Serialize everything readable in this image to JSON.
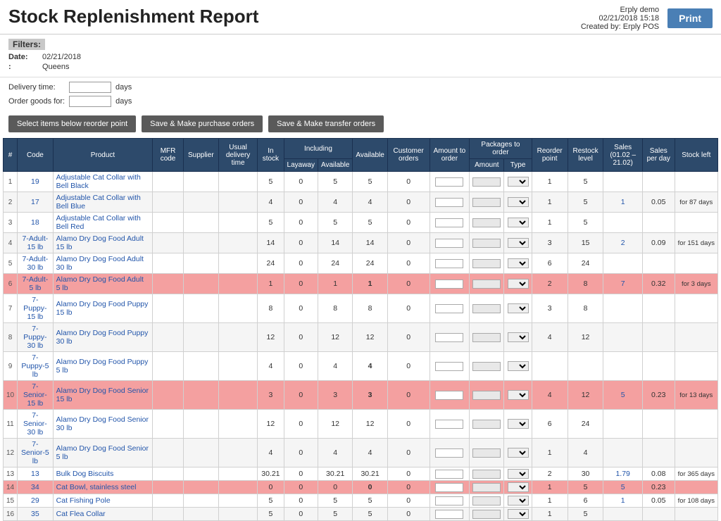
{
  "header": {
    "title": "Stock Replenishment Report",
    "company": "Erply demo",
    "datetime": "02/21/2018 15:18",
    "created_by": "Created by: Erply POS",
    "print_label": "Print"
  },
  "filters": {
    "label": "Filters:",
    "date_label": "Date:",
    "date_value": "02/21/2018",
    "location_label": ":",
    "location_value": "Queens"
  },
  "delivery": {
    "delivery_label": "Delivery time:",
    "delivery_unit": "days",
    "order_label": "Order goods for:",
    "order_unit": "days"
  },
  "buttons": {
    "select_items": "Select items below reorder point",
    "save_purchase": "Save & Make purchase orders",
    "save_transfer": "Save & Make transfer orders"
  },
  "table": {
    "col_headers": {
      "row_num": "#",
      "code": "Code",
      "product": "Product",
      "mfr_code": "MFR code",
      "supplier": "Supplier",
      "usual_delivery": "Usual delivery time",
      "in_stock": "In stock",
      "including": "Including",
      "layaway": "Layaway",
      "available": "Available",
      "customer_orders": "Customer orders",
      "amount_to_order": "Amount to order",
      "packages_to_order": "Packages to order",
      "amount": "Amount",
      "type": "Type",
      "reorder_point": "Reorder point",
      "restock_level": "Restock level",
      "sales": "Sales (01.02 – 21.02)",
      "sales_per_day": "Sales per day",
      "stock_left": "Stock left"
    },
    "rows": [
      {
        "num": "1",
        "code": "19",
        "product": "Adjustable Cat Collar with Bell Black",
        "mfr_code": "",
        "supplier": "",
        "usual_delivery": "",
        "in_stock": "5",
        "layaway": "0",
        "available": "5",
        "customer_orders": "0",
        "amount_to_order": "",
        "packages_amount": "",
        "packages_type": "",
        "reorder_point": "1",
        "restock_level": "5",
        "sales": "",
        "sales_per_day": "",
        "stock_left": "",
        "highlight": false
      },
      {
        "num": "2",
        "code": "17",
        "product": "Adjustable Cat Collar with Bell Blue",
        "mfr_code": "",
        "supplier": "",
        "usual_delivery": "",
        "in_stock": "4",
        "layaway": "0",
        "available": "4",
        "customer_orders": "0",
        "amount_to_order": "",
        "packages_amount": "",
        "packages_type": "",
        "reorder_point": "1",
        "restock_level": "5",
        "sales": "1",
        "sales_per_day": "0.05",
        "stock_left": "for 87 days",
        "highlight": false
      },
      {
        "num": "3",
        "code": "18",
        "product": "Adjustable Cat Collar with Bell Red",
        "mfr_code": "",
        "supplier": "",
        "usual_delivery": "",
        "in_stock": "5",
        "layaway": "0",
        "available": "5",
        "customer_orders": "0",
        "amount_to_order": "",
        "packages_amount": "",
        "packages_type": "",
        "reorder_point": "1",
        "restock_level": "5",
        "sales": "",
        "sales_per_day": "",
        "stock_left": "",
        "highlight": false
      },
      {
        "num": "4",
        "code": "7-Adult-15 lb",
        "product": "Alamo Dry Dog Food Adult 15 lb",
        "mfr_code": "",
        "supplier": "",
        "usual_delivery": "",
        "in_stock": "14",
        "layaway": "0",
        "available": "14",
        "customer_orders": "0",
        "amount_to_order": "",
        "packages_amount": "",
        "packages_type": "",
        "reorder_point": "3",
        "restock_level": "15",
        "sales": "2",
        "sales_per_day": "0.09",
        "stock_left": "for 151 days",
        "highlight": false
      },
      {
        "num": "5",
        "code": "7-Adult-30 lb",
        "product": "Alamo Dry Dog Food Adult 30 lb",
        "mfr_code": "",
        "supplier": "",
        "usual_delivery": "",
        "in_stock": "24",
        "layaway": "0",
        "available": "24",
        "customer_orders": "0",
        "amount_to_order": "",
        "packages_amount": "",
        "packages_type": "",
        "reorder_point": "6",
        "restock_level": "24",
        "sales": "",
        "sales_per_day": "",
        "stock_left": "",
        "highlight": false
      },
      {
        "num": "6",
        "code": "7-Adult-5 lb",
        "product": "Alamo Dry Dog Food Adult 5 lb",
        "mfr_code": "",
        "supplier": "",
        "usual_delivery": "",
        "in_stock": "1",
        "layaway": "0",
        "available": "1",
        "customer_orders": "0",
        "amount_to_order": "",
        "packages_amount": "",
        "packages_type": "",
        "reorder_point": "2",
        "restock_level": "8",
        "sales": "7",
        "sales_per_day": "0.32",
        "stock_left": "for 3 days",
        "highlight": true
      },
      {
        "num": "7",
        "code": "7-Puppy-15 lb",
        "product": "Alamo Dry Dog Food Puppy 15 lb",
        "mfr_code": "",
        "supplier": "",
        "usual_delivery": "",
        "in_stock": "8",
        "layaway": "0",
        "available": "8",
        "customer_orders": "0",
        "amount_to_order": "",
        "packages_amount": "",
        "packages_type": "",
        "reorder_point": "3",
        "restock_level": "8",
        "sales": "",
        "sales_per_day": "",
        "stock_left": "",
        "highlight": false
      },
      {
        "num": "8",
        "code": "7-Puppy-30 lb",
        "product": "Alamo Dry Dog Food Puppy 30 lb",
        "mfr_code": "",
        "supplier": "",
        "usual_delivery": "",
        "in_stock": "12",
        "layaway": "0",
        "available": "12",
        "customer_orders": "0",
        "amount_to_order": "",
        "packages_amount": "",
        "packages_type": "",
        "reorder_point": "4",
        "restock_level": "12",
        "sales": "",
        "sales_per_day": "",
        "stock_left": "",
        "highlight": false
      },
      {
        "num": "9",
        "code": "7-Puppy-5 lb",
        "product": "Alamo Dry Dog Food Puppy 5 lb",
        "mfr_code": "",
        "supplier": "",
        "usual_delivery": "",
        "in_stock": "4",
        "layaway": "0",
        "available": "4",
        "customer_orders": "0",
        "amount_to_order": "",
        "packages_amount": "",
        "packages_type": "",
        "reorder_point": "",
        "restock_level": "",
        "sales": "",
        "sales_per_day": "",
        "stock_left": "",
        "highlight": false
      },
      {
        "num": "10",
        "code": "7-Senior-15 lb",
        "product": "Alamo Dry Dog Food Senior 15 lb",
        "mfr_code": "",
        "supplier": "",
        "usual_delivery": "",
        "in_stock": "3",
        "layaway": "0",
        "available": "3",
        "customer_orders": "0",
        "amount_to_order": "",
        "packages_amount": "",
        "packages_type": "",
        "reorder_point": "4",
        "restock_level": "12",
        "sales": "5",
        "sales_per_day": "0.23",
        "stock_left": "for 13 days",
        "highlight": true
      },
      {
        "num": "11",
        "code": "7-Senior-30 lb",
        "product": "Alamo Dry Dog Food Senior 30 lb",
        "mfr_code": "",
        "supplier": "",
        "usual_delivery": "",
        "in_stock": "12",
        "layaway": "0",
        "available": "12",
        "customer_orders": "0",
        "amount_to_order": "",
        "packages_amount": "",
        "packages_type": "",
        "reorder_point": "6",
        "restock_level": "24",
        "sales": "",
        "sales_per_day": "",
        "stock_left": "",
        "highlight": false
      },
      {
        "num": "12",
        "code": "7-Senior-5 lb",
        "product": "Alamo Dry Dog Food Senior 5 lb",
        "mfr_code": "",
        "supplier": "",
        "usual_delivery": "",
        "in_stock": "4",
        "layaway": "0",
        "available": "4",
        "customer_orders": "0",
        "amount_to_order": "",
        "packages_amount": "",
        "packages_type": "",
        "reorder_point": "1",
        "restock_level": "4",
        "sales": "",
        "sales_per_day": "",
        "stock_left": "",
        "highlight": false
      },
      {
        "num": "13",
        "code": "13",
        "product": "Bulk Dog Biscuits",
        "mfr_code": "",
        "supplier": "",
        "usual_delivery": "",
        "in_stock": "30.21",
        "layaway": "0",
        "available": "30.21",
        "customer_orders": "0",
        "amount_to_order": "",
        "packages_amount": "",
        "packages_type": "",
        "reorder_point": "2",
        "restock_level": "30",
        "sales": "1.79",
        "sales_per_day": "0.08",
        "stock_left": "for 365 days",
        "highlight": false
      },
      {
        "num": "14",
        "code": "34",
        "product": "Cat Bowl, stainless steel",
        "mfr_code": "",
        "supplier": "",
        "usual_delivery": "",
        "in_stock": "0",
        "layaway": "0",
        "available": "0",
        "customer_orders": "0",
        "amount_to_order": "",
        "packages_amount": "",
        "packages_type": "",
        "reorder_point": "1",
        "restock_level": "5",
        "sales": "5",
        "sales_per_day": "0.23",
        "stock_left": "",
        "highlight": true
      },
      {
        "num": "15",
        "code": "29",
        "product": "Cat Fishing Pole",
        "mfr_code": "",
        "supplier": "",
        "usual_delivery": "",
        "in_stock": "5",
        "layaway": "0",
        "available": "5",
        "customer_orders": "0",
        "amount_to_order": "",
        "packages_amount": "",
        "packages_type": "",
        "reorder_point": "1",
        "restock_level": "6",
        "sales": "1",
        "sales_per_day": "0.05",
        "stock_left": "for 108 days",
        "highlight": false
      },
      {
        "num": "16",
        "code": "35",
        "product": "Cat Flea Collar",
        "mfr_code": "",
        "supplier": "",
        "usual_delivery": "",
        "in_stock": "5",
        "layaway": "0",
        "available": "5",
        "customer_orders": "0",
        "amount_to_order": "",
        "packages_amount": "",
        "packages_type": "",
        "reorder_point": "1",
        "restock_level": "5",
        "sales": "",
        "sales_per_day": "",
        "stock_left": "",
        "highlight": false
      }
    ]
  }
}
